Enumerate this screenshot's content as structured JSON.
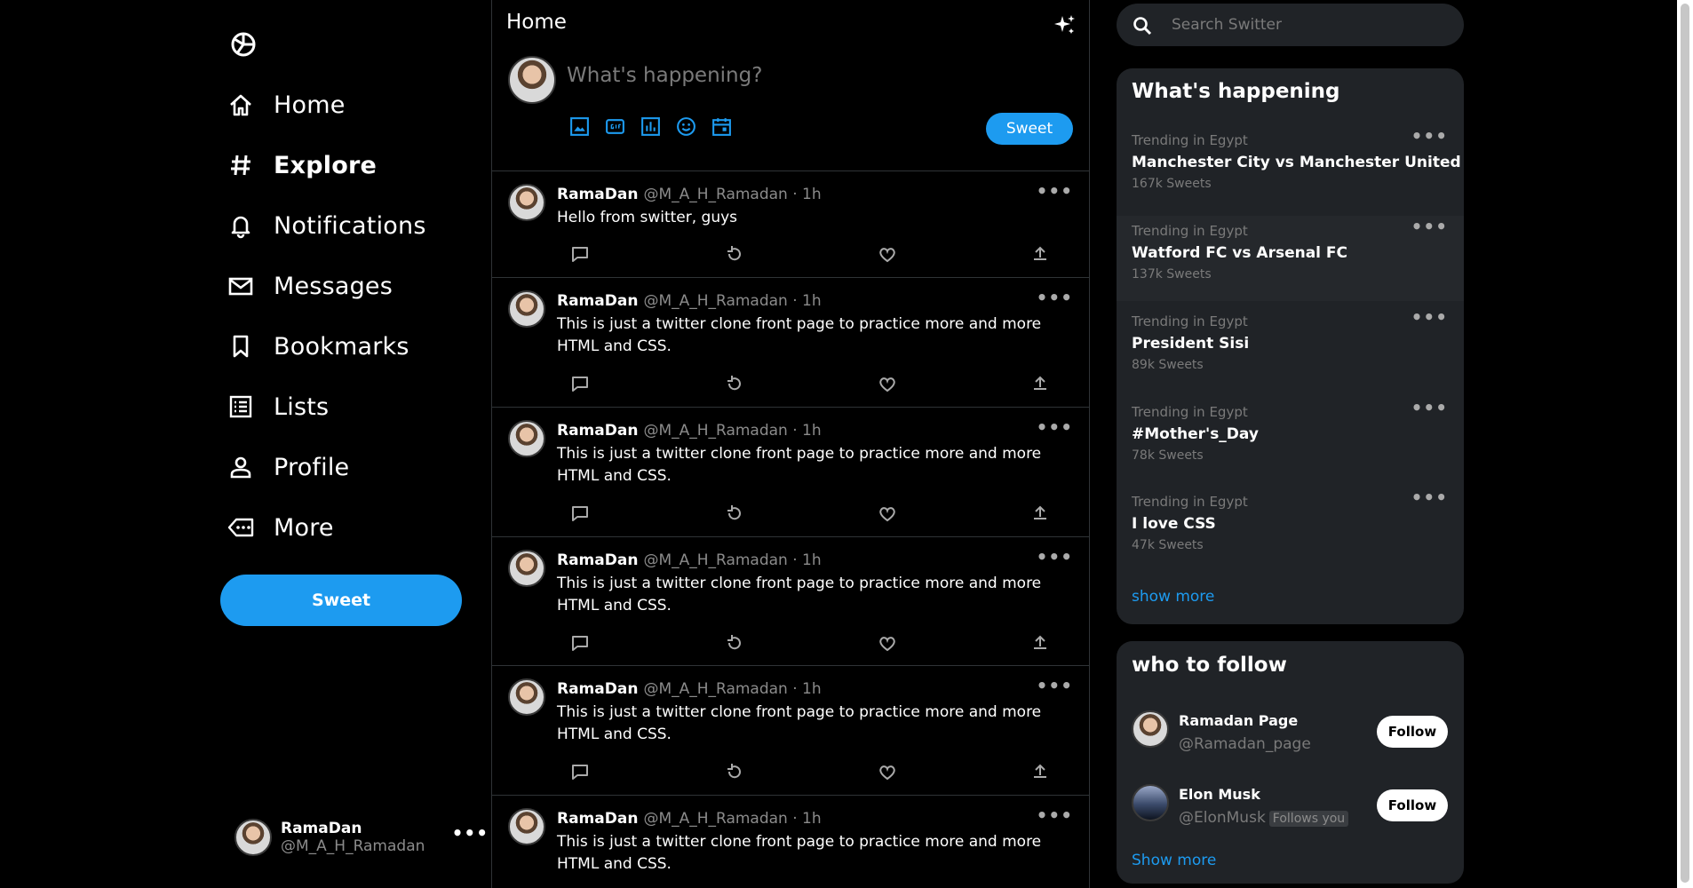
{
  "sidebar": {
    "logo_icon": "logo-icon",
    "items": [
      {
        "label": "Home",
        "icon": "home-icon"
      },
      {
        "label": "Explore",
        "icon": "hash-icon",
        "active": true
      },
      {
        "label": "Notifications",
        "icon": "bell-icon"
      },
      {
        "label": "Messages",
        "icon": "mail-icon"
      },
      {
        "label": "Bookmarks",
        "icon": "bookmark-icon"
      },
      {
        "label": "Lists",
        "icon": "list-icon"
      },
      {
        "label": "Profile",
        "icon": "person-icon"
      },
      {
        "label": "More",
        "icon": "more-icon"
      }
    ],
    "sweet_label": "Sweet",
    "account": {
      "name": "RamaDan",
      "handle": "@M_A_H_Ramadan",
      "more": "•••"
    }
  },
  "feed": {
    "title": "Home",
    "composer": {
      "placeholder": "What's happening?",
      "button_label": "Sweet"
    },
    "posts": [
      {
        "name": "RamaDan",
        "handle": "@M_A_H_Ramadan",
        "time": "· 1h",
        "text": "Hello from switter, guys",
        "more": "•••"
      },
      {
        "name": "RamaDan",
        "handle": "@M_A_H_Ramadan",
        "time": "· 1h",
        "text": "This is just a twitter clone front page to practice more and more HTML and CSS.",
        "more": "•••"
      },
      {
        "name": "RamaDan",
        "handle": "@M_A_H_Ramadan",
        "time": "· 1h",
        "text": "This is just a twitter clone front page to practice more and more HTML and CSS.",
        "more": "•••"
      },
      {
        "name": "RamaDan",
        "handle": "@M_A_H_Ramadan",
        "time": "· 1h",
        "text": "This is just a twitter clone front page to practice more and more HTML and CSS.",
        "more": "•••"
      },
      {
        "name": "RamaDan",
        "handle": "@M_A_H_Ramadan",
        "time": "· 1h",
        "text": "This is just a twitter clone front page to practice more and more HTML and CSS.",
        "more": "•••"
      },
      {
        "name": "RamaDan",
        "handle": "@M_A_H_Ramadan",
        "time": "· 1h",
        "text": "This is just a twitter clone front page to practice more and more HTML and CSS.",
        "more": "•••"
      }
    ]
  },
  "right": {
    "search_placeholder": "Search Switter",
    "trending": {
      "title": "What's happening",
      "items": [
        {
          "meta": "Trending in Egypt",
          "topic": "Manchester City vs Manchester United",
          "count": "167k Sweets",
          "more": "•••"
        },
        {
          "meta": "Trending in Egypt",
          "topic": "Watford FC vs Arsenal FC",
          "count": "137k Sweets",
          "more": "•••"
        },
        {
          "meta": "Trending in Egypt",
          "topic": "President Sisi",
          "count": "89k Sweets",
          "more": "•••"
        },
        {
          "meta": "Trending in Egypt",
          "topic": "#Mother's_Day",
          "count": "78k Sweets",
          "more": "•••"
        },
        {
          "meta": "Trending in Egypt",
          "topic": "I love CSS",
          "count": "47k Sweets",
          "more": "•••"
        }
      ],
      "show_more": "show more"
    },
    "follow": {
      "title": "who to follow",
      "items": [
        {
          "name": "Ramadan Page",
          "handle": "@Ramadan_page",
          "badge": "",
          "button": "Follow"
        },
        {
          "name": "Elon Musk",
          "handle": "@ElonMusk",
          "badge": "Follows you",
          "button": "Follow"
        }
      ],
      "show_more": "Show more"
    }
  },
  "colors": {
    "accent": "#1d9bf0",
    "background": "#000000",
    "panel": "#202327",
    "muted": "#7a7a7a"
  }
}
